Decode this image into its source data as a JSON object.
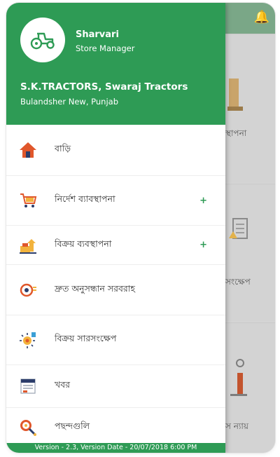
{
  "header": {
    "user_name": "Sharvari",
    "user_role": "Store Manager",
    "store_name": "S.K.TRACTORS, Swaraj Tractors",
    "store_location": "Bulandsher New, Punjab"
  },
  "menu": [
    {
      "label": "বাড়ি",
      "icon": "home-icon",
      "expandable": false
    },
    {
      "label": "নির্দেশ ব্যাবস্থাপনা",
      "icon": "cart-icon",
      "expandable": true
    },
    {
      "label": "বিক্রয় ব্যবস্থাপনা",
      "icon": "sales-icon",
      "expandable": true
    },
    {
      "label": "দ্রুত অনুসন্ধান সরবরাহ",
      "icon": "quick-search-icon",
      "expandable": false
    },
    {
      "label": "বিক্রয় সারসংক্ষেপ",
      "icon": "summary-icon",
      "expandable": false
    },
    {
      "label": "খবর",
      "icon": "news-icon",
      "expandable": false
    },
    {
      "label": "পছন্দগুলি",
      "icon": "preferences-icon",
      "expandable": false
    }
  ],
  "expand_symbol": "+",
  "footer": {
    "version_text": "Version - 2.3, Version Date - 20/07/2018 6:00 PM"
  },
  "background": {
    "labels": [
      "স্থাপনা",
      "সংক্ষেপ",
      "স ন্যায়"
    ]
  },
  "colors": {
    "brand_green": "#2e9b55",
    "dimmed_topbar": "#7aa787"
  }
}
